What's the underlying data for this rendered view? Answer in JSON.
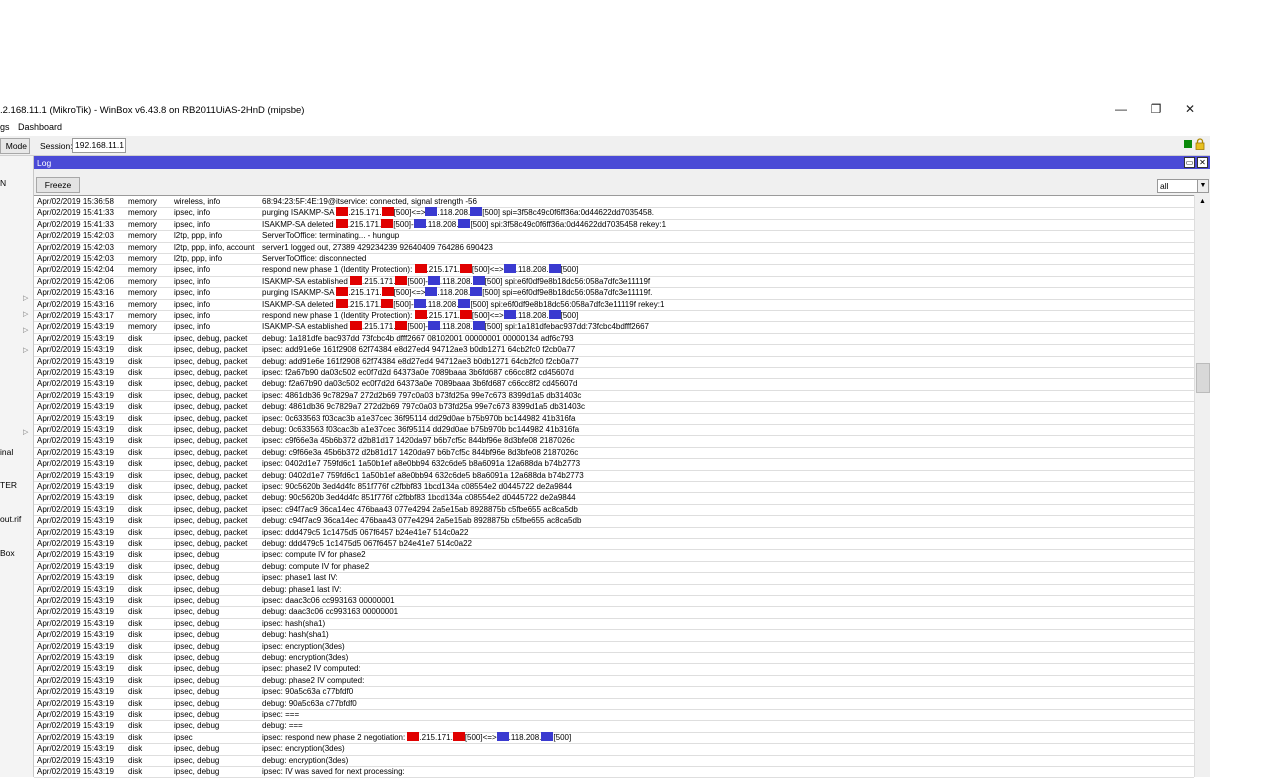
{
  "window": {
    "title": ".2.168.11.1 (MikroTik) - WinBox v6.43.8 on RB2011UiAS-2HnD (mipsbe)",
    "minimize": "—",
    "restore": "❐",
    "close": "✕"
  },
  "menu": {
    "items": [
      "gs",
      "Dashboard"
    ]
  },
  "toolbar": {
    "mode_label": "Mode",
    "session_label": "Session:",
    "session_value": "192.168.11.1"
  },
  "sidebar": {
    "labels": [
      "N",
      "inal",
      "TER",
      "out.rif",
      "Box"
    ]
  },
  "log": {
    "title": "Log",
    "freeze_label": "Freeze",
    "filter_value": "all",
    "rows": [
      {
        "time": "Apr/02/2019 15:36:58",
        "buffer": "memory",
        "topics": "wireless, info",
        "msg": [
          "68:94:23:5F:4E:19@itservice: connected, signal strength -56"
        ]
      },
      {
        "time": "Apr/02/2019 15:41:33",
        "buffer": "memory",
        "topics": "ipsec, info",
        "msg": [
          "purging ISAKMP-SA ",
          "R",
          ".215.171.",
          "R",
          "[500]<=>",
          "B",
          ".118.208.",
          "B",
          "[500] spi=3f58c49c0f6ff36a:0d44622dd7035458."
        ]
      },
      {
        "time": "Apr/02/2019 15:41:33",
        "buffer": "memory",
        "topics": "ipsec, info",
        "msg": [
          "ISAKMP-SA deleted ",
          "R",
          ".215.171.",
          "R",
          "[500]-",
          "B",
          ".118.208.",
          "B",
          "[500] spi:3f58c49c0f6ff36a:0d44622dd7035458 rekey:1"
        ]
      },
      {
        "time": "Apr/02/2019 15:42:03",
        "buffer": "memory",
        "topics": "l2tp, ppp, info",
        "msg": [
          "ServerToOffice: terminating... - hungup"
        ]
      },
      {
        "time": "Apr/02/2019 15:42:03",
        "buffer": "memory",
        "topics": "l2tp, ppp, info, account",
        "msg": [
          "server1 logged out, 27389 429234239 92640409 764286 690423"
        ]
      },
      {
        "time": "Apr/02/2019 15:42:03",
        "buffer": "memory",
        "topics": "l2tp, ppp, info",
        "msg": [
          "ServerToOffice: disconnected"
        ]
      },
      {
        "time": "Apr/02/2019 15:42:04",
        "buffer": "memory",
        "topics": "ipsec, info",
        "msg": [
          "respond new phase 1 (Identity Protection): ",
          "R",
          ".215.171.",
          "R",
          "[500]<=>",
          "B",
          ".118.208.",
          "B",
          "[500]"
        ]
      },
      {
        "time": "Apr/02/2019 15:42:06",
        "buffer": "memory",
        "topics": "ipsec, info",
        "msg": [
          "ISAKMP-SA established ",
          "R",
          ".215.171.",
          "R",
          "[500]-",
          "B",
          ".118.208.",
          "B",
          "[500] spi:e6f0df9e8b18dc56:058a7dfc3e11119f"
        ]
      },
      {
        "time": "Apr/02/2019 15:43:16",
        "buffer": "memory",
        "topics": "ipsec, info",
        "msg": [
          "purging ISAKMP-SA ",
          "R",
          ".215.171.",
          "R",
          "[500]<=>",
          "B",
          ".118.208.",
          "B",
          "[500] spi=e6f0df9e8b18dc56:058a7dfc3e11119f."
        ]
      },
      {
        "time": "Apr/02/2019 15:43:16",
        "buffer": "memory",
        "topics": "ipsec, info",
        "msg": [
          "ISAKMP-SA deleted ",
          "R",
          ".215.171.",
          "R",
          "[500]-",
          "B",
          ".118.208.",
          "B",
          "[500] spi:e6f0df9e8b18dc56:058a7dfc3e11119f rekey:1"
        ]
      },
      {
        "time": "Apr/02/2019 15:43:17",
        "buffer": "memory",
        "topics": "ipsec, info",
        "msg": [
          "respond new phase 1 (Identity Protection): ",
          "R",
          ".215.171.",
          "R",
          "[500]<=>",
          "B",
          ".118.208.",
          "B",
          "[500]"
        ]
      },
      {
        "time": "Apr/02/2019 15:43:19",
        "buffer": "memory",
        "topics": "ipsec, info",
        "msg": [
          "ISAKMP-SA established ",
          "R",
          ".215.171.",
          "R",
          "[500]-",
          "B",
          ".118.208.",
          "B",
          "[500] spi:1a181dfebac937dd:73fcbc4bdfff2667"
        ]
      },
      {
        "time": "Apr/02/2019 15:43:19",
        "buffer": "disk",
        "topics": "ipsec, debug, packet",
        "msg": [
          "debug: 1a181dfe bac937dd 73fcbc4b dfff2667 08102001 00000001 00000134 adf6c793"
        ]
      },
      {
        "time": "Apr/02/2019 15:43:19",
        "buffer": "disk",
        "topics": "ipsec, debug, packet",
        "msg": [
          "ipsec: add91e6e 161f2908 62f74384 e8d27ed4 94712ae3 b0db1271 64cb2fc0 f2cb0a77"
        ]
      },
      {
        "time": "Apr/02/2019 15:43:19",
        "buffer": "disk",
        "topics": "ipsec, debug, packet",
        "msg": [
          "debug: add91e6e 161f2908 62f74384 e8d27ed4 94712ae3 b0db1271 64cb2fc0 f2cb0a77"
        ]
      },
      {
        "time": "Apr/02/2019 15:43:19",
        "buffer": "disk",
        "topics": "ipsec, debug, packet",
        "msg": [
          "ipsec: f2a67b90 da03c502 ec0f7d2d 64373a0e 7089baaa 3b6fd687 c66cc8f2 cd45607d"
        ]
      },
      {
        "time": "Apr/02/2019 15:43:19",
        "buffer": "disk",
        "topics": "ipsec, debug, packet",
        "msg": [
          "debug: f2a67b90 da03c502 ec0f7d2d 64373a0e 7089baaa 3b6fd687 c66cc8f2 cd45607d"
        ]
      },
      {
        "time": "Apr/02/2019 15:43:19",
        "buffer": "disk",
        "topics": "ipsec, debug, packet",
        "msg": [
          "ipsec: 4861db36 9c7829a7 272d2b69 797c0a03 b73fd25a 99e7c673 8399d1a5 db31403c"
        ]
      },
      {
        "time": "Apr/02/2019 15:43:19",
        "buffer": "disk",
        "topics": "ipsec, debug, packet",
        "msg": [
          "debug: 4861db36 9c7829a7 272d2b69 797c0a03 b73fd25a 99e7c673 8399d1a5 db31403c"
        ]
      },
      {
        "time": "Apr/02/2019 15:43:19",
        "buffer": "disk",
        "topics": "ipsec, debug, packet",
        "msg": [
          "ipsec: 0c633563 f03cac3b a1e37cec 36f95114 dd29d0ae b75b970b bc144982 41b316fa"
        ]
      },
      {
        "time": "Apr/02/2019 15:43:19",
        "buffer": "disk",
        "topics": "ipsec, debug, packet",
        "msg": [
          "debug: 0c633563 f03cac3b a1e37cec 36f95114 dd29d0ae b75b970b bc144982 41b316fa"
        ]
      },
      {
        "time": "Apr/02/2019 15:43:19",
        "buffer": "disk",
        "topics": "ipsec, debug, packet",
        "msg": [
          "ipsec: c9f66e3a 45b6b372 d2b81d17 1420da97 b6b7cf5c 844bf96e 8d3bfe08 2187026c"
        ]
      },
      {
        "time": "Apr/02/2019 15:43:19",
        "buffer": "disk",
        "topics": "ipsec, debug, packet",
        "msg": [
          "debug: c9f66e3a 45b6b372 d2b81d17 1420da97 b6b7cf5c 844bf96e 8d3bfe08 2187026c"
        ]
      },
      {
        "time": "Apr/02/2019 15:43:19",
        "buffer": "disk",
        "topics": "ipsec, debug, packet",
        "msg": [
          "ipsec: 0402d1e7 759fd6c1 1a50b1ef a8e0bb94 632c6de5 b8a6091a 12a688da b74b2773"
        ]
      },
      {
        "time": "Apr/02/2019 15:43:19",
        "buffer": "disk",
        "topics": "ipsec, debug, packet",
        "msg": [
          "debug: 0402d1e7 759fd6c1 1a50b1ef a8e0bb94 632c6de5 b8a6091a 12a688da b74b2773"
        ]
      },
      {
        "time": "Apr/02/2019 15:43:19",
        "buffer": "disk",
        "topics": "ipsec, debug, packet",
        "msg": [
          "ipsec: 90c5620b 3ed4d4fc 851f776f c2fbbf83 1bcd134a c08554e2 d0445722 de2a9844"
        ]
      },
      {
        "time": "Apr/02/2019 15:43:19",
        "buffer": "disk",
        "topics": "ipsec, debug, packet",
        "msg": [
          "debug: 90c5620b 3ed4d4fc 851f776f c2fbbf83 1bcd134a c08554e2 d0445722 de2a9844"
        ]
      },
      {
        "time": "Apr/02/2019 15:43:19",
        "buffer": "disk",
        "topics": "ipsec, debug, packet",
        "msg": [
          "ipsec: c94f7ac9 36ca14ec 476baa43 077e4294 2a5e15ab 8928875b c5fbe655 ac8ca5db"
        ]
      },
      {
        "time": "Apr/02/2019 15:43:19",
        "buffer": "disk",
        "topics": "ipsec, debug, packet",
        "msg": [
          "debug: c94f7ac9 36ca14ec 476baa43 077e4294 2a5e15ab 8928875b c5fbe655 ac8ca5db"
        ]
      },
      {
        "time": "Apr/02/2019 15:43:19",
        "buffer": "disk",
        "topics": "ipsec, debug, packet",
        "msg": [
          "ipsec: ddd479c5 1c1475d5 067f6457 b24e41e7 514c0a22"
        ]
      },
      {
        "time": "Apr/02/2019 15:43:19",
        "buffer": "disk",
        "topics": "ipsec, debug, packet",
        "msg": [
          "debug: ddd479c5 1c1475d5 067f6457 b24e41e7 514c0a22"
        ]
      },
      {
        "time": "Apr/02/2019 15:43:19",
        "buffer": "disk",
        "topics": "ipsec, debug",
        "msg": [
          "ipsec: compute IV for phase2"
        ]
      },
      {
        "time": "Apr/02/2019 15:43:19",
        "buffer": "disk",
        "topics": "ipsec, debug",
        "msg": [
          "debug: compute IV for phase2"
        ]
      },
      {
        "time": "Apr/02/2019 15:43:19",
        "buffer": "disk",
        "topics": "ipsec, debug",
        "msg": [
          "ipsec: phase1 last IV:"
        ]
      },
      {
        "time": "Apr/02/2019 15:43:19",
        "buffer": "disk",
        "topics": "ipsec, debug",
        "msg": [
          "debug: phase1 last IV:"
        ]
      },
      {
        "time": "Apr/02/2019 15:43:19",
        "buffer": "disk",
        "topics": "ipsec, debug",
        "msg": [
          "ipsec: daac3c06 cc993163 00000001"
        ]
      },
      {
        "time": "Apr/02/2019 15:43:19",
        "buffer": "disk",
        "topics": "ipsec, debug",
        "msg": [
          "debug: daac3c06 cc993163 00000001"
        ]
      },
      {
        "time": "Apr/02/2019 15:43:19",
        "buffer": "disk",
        "topics": "ipsec, debug",
        "msg": [
          "ipsec: hash(sha1)"
        ]
      },
      {
        "time": "Apr/02/2019 15:43:19",
        "buffer": "disk",
        "topics": "ipsec, debug",
        "msg": [
          "debug: hash(sha1)"
        ]
      },
      {
        "time": "Apr/02/2019 15:43:19",
        "buffer": "disk",
        "topics": "ipsec, debug",
        "msg": [
          "ipsec: encryption(3des)"
        ]
      },
      {
        "time": "Apr/02/2019 15:43:19",
        "buffer": "disk",
        "topics": "ipsec, debug",
        "msg": [
          "debug: encryption(3des)"
        ]
      },
      {
        "time": "Apr/02/2019 15:43:19",
        "buffer": "disk",
        "topics": "ipsec, debug",
        "msg": [
          "ipsec: phase2 IV computed:"
        ]
      },
      {
        "time": "Apr/02/2019 15:43:19",
        "buffer": "disk",
        "topics": "ipsec, debug",
        "msg": [
          "debug: phase2 IV computed:"
        ]
      },
      {
        "time": "Apr/02/2019 15:43:19",
        "buffer": "disk",
        "topics": "ipsec, debug",
        "msg": [
          "ipsec: 90a5c63a c77bfdf0"
        ]
      },
      {
        "time": "Apr/02/2019 15:43:19",
        "buffer": "disk",
        "topics": "ipsec, debug",
        "msg": [
          "debug: 90a5c63a c77bfdf0"
        ]
      },
      {
        "time": "Apr/02/2019 15:43:19",
        "buffer": "disk",
        "topics": "ipsec, debug",
        "msg": [
          "ipsec: ==="
        ]
      },
      {
        "time": "Apr/02/2019 15:43:19",
        "buffer": "disk",
        "topics": "ipsec, debug",
        "msg": [
          "debug: ==="
        ]
      },
      {
        "time": "Apr/02/2019 15:43:19",
        "buffer": "disk",
        "topics": "ipsec",
        "msg": [
          "ipsec: respond new phase 2 negotiation: ",
          "R",
          ".215.171.",
          "R",
          "[500]<=>",
          "B",
          ".118.208.",
          "B",
          "[500]"
        ]
      },
      {
        "time": "Apr/02/2019 15:43:19",
        "buffer": "disk",
        "topics": "ipsec, debug",
        "msg": [
          "ipsec: encryption(3des)"
        ]
      },
      {
        "time": "Apr/02/2019 15:43:19",
        "buffer": "disk",
        "topics": "ipsec, debug",
        "msg": [
          "debug: encryption(3des)"
        ]
      },
      {
        "time": "Apr/02/2019 15:43:19",
        "buffer": "disk",
        "topics": "ipsec, debug",
        "msg": [
          "ipsec: IV was saved for next processing:"
        ]
      }
    ]
  },
  "colors": {
    "header_blue": "#4a4ad6",
    "redact_red": "#e00000",
    "redact_blue": "#3a3ad0"
  }
}
